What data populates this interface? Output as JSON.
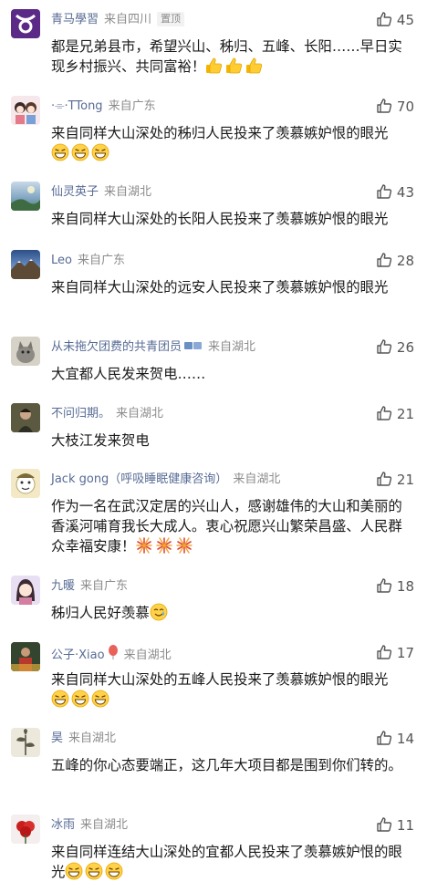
{
  "comments": [
    {
      "username": "青马學習",
      "location": "来自四川",
      "pinned_label": "置顶",
      "likes": "45",
      "text": "都是兄弟县市，希望兴山、秭归、五峰、长阳……早日实现乡村振兴、共同富裕！",
      "emoji": [
        "thumbs-up",
        "thumbs-up",
        "thumbs-up"
      ],
      "avatar": "taurus-icon"
    },
    {
      "username": "·⌯·TTong",
      "location": "来自广东",
      "likes": "70",
      "text": "来自同样大山深处的秭归人民投来了羡慕嫉妒恨的眼光",
      "emoji": [
        "grin",
        "grin",
        "grin"
      ],
      "avatar": "couple-cartoon"
    },
    {
      "username": "仙灵英子",
      "location": "来自湖北",
      "likes": "43",
      "text": "来自同样大山深处的长阳人民投来了羡慕嫉妒恨的眼光",
      "emoji": [],
      "avatar": "landscape"
    },
    {
      "username": "Leo",
      "location": "来自广东",
      "likes": "28",
      "text": "来自同样大山深处的远安人民投来了羡慕嫉妒恨的眼光",
      "emoji": [],
      "avatar": "mountain"
    },
    {
      "username": "从未拖欠团费的共青团员",
      "location": "来自湖北",
      "likes": "26",
      "text": "大宜都人民发来贺电……",
      "emoji": [],
      "avatar": "cat-photo"
    },
    {
      "username": "不问归期。",
      "location": "来自湖北",
      "likes": "21",
      "text": "大枝江发来贺电",
      "emoji": [],
      "avatar": "portrait"
    },
    {
      "username": "Jack gong（呼吸睡眠健康咨询）",
      "location": "来自湖北",
      "likes": "21",
      "text": "作为一名在武汉定居的兴山人，感谢雄伟的大山和美丽的香溪河哺育我长大成人。衷心祝愿兴山繁荣昌盛、人民群众幸福安康！",
      "emoji": [
        "firework",
        "firework",
        "firework"
      ],
      "avatar": "cartoon-face"
    },
    {
      "username": "九暖",
      "location": "来自广东",
      "likes": "18",
      "text": "秭归人民好羡慕",
      "emoji": [
        "teary-smile"
      ],
      "avatar": "girl-cartoon"
    },
    {
      "username": "公子·Xiao",
      "location": "来自湖北",
      "likes": "17",
      "text": "来自同样大山深处的五峰人民投来了羡慕嫉妒恨的眼光",
      "emoji": [
        "grin",
        "grin",
        "grin"
      ],
      "avatar": "photo-person"
    },
    {
      "username": "昊",
      "location": "来自湖北",
      "likes": "14",
      "text": "五峰的你心态要端正，这几年大项目都是围到你们转的。",
      "emoji": [],
      "avatar": "plant-art"
    },
    {
      "username": "冰雨",
      "location": "来自湖北",
      "likes": "11",
      "text": "来自同样连结大山深处的宜都人民投来了羡慕嫉妒恨的眼光",
      "emoji": [
        "grin",
        "grin",
        "grin"
      ],
      "avatar": "red-flower"
    }
  ],
  "colors": {
    "username": "#576b95",
    "location": "#8c8c8c",
    "text": "#1a1a1a",
    "likes": "#555555"
  }
}
